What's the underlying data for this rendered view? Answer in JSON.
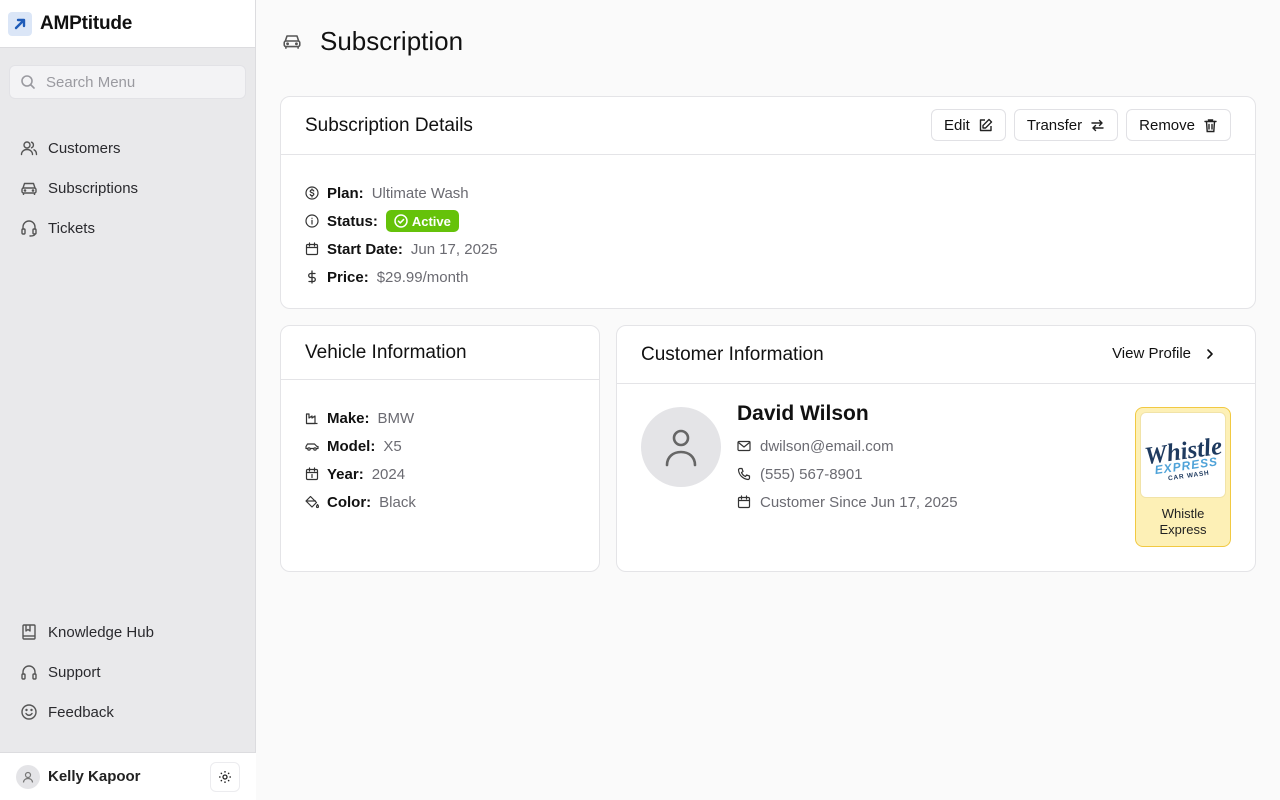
{
  "app": {
    "name": "AMPtitude"
  },
  "search": {
    "placeholder": "Search Menu"
  },
  "nav": {
    "top": [
      {
        "label": "Customers",
        "icon": "users-icon"
      },
      {
        "label": "Subscriptions",
        "icon": "car-icon"
      },
      {
        "label": "Tickets",
        "icon": "headset-icon"
      }
    ],
    "bottom": [
      {
        "label": "Knowledge Hub",
        "icon": "book-icon"
      },
      {
        "label": "Support",
        "icon": "headphones-icon"
      },
      {
        "label": "Feedback",
        "icon": "smile-icon"
      }
    ]
  },
  "user": {
    "name": "Kelly Kapoor"
  },
  "page": {
    "title": "Subscription"
  },
  "subscription": {
    "title": "Subscription Details",
    "actions": {
      "edit": "Edit",
      "transfer": "Transfer",
      "remove": "Remove"
    },
    "plan_label": "Plan:",
    "plan": "Ultimate Wash",
    "status_label": "Status:",
    "status": "Active",
    "start_label": "Start Date:",
    "start": "Jun 17, 2025",
    "price_label": "Price:",
    "price": "$29.99/month"
  },
  "vehicle": {
    "title": "Vehicle Information",
    "make_label": "Make:",
    "make": "BMW",
    "model_label": "Model:",
    "model": "X5",
    "year_label": "Year:",
    "year": "2024",
    "color_label": "Color:",
    "color": "Black"
  },
  "customer": {
    "title": "Customer Information",
    "view_profile": "View Profile",
    "name": "David Wilson",
    "email": "dwilson@email.com",
    "phone": "(555) 567-8901",
    "since": "Customer Since Jun 17, 2025",
    "brand": {
      "name": "Whistle Express",
      "logo_line1": "Whistle",
      "logo_line2": "EXPRESS",
      "logo_line3": "CAR WASH"
    }
  },
  "colors": {
    "accent_blue": "#1e5bb8",
    "status_active": "#65c20a",
    "brand_tile_bg": "#fdf0b6",
    "brand_tile_border": "#f1c942"
  }
}
